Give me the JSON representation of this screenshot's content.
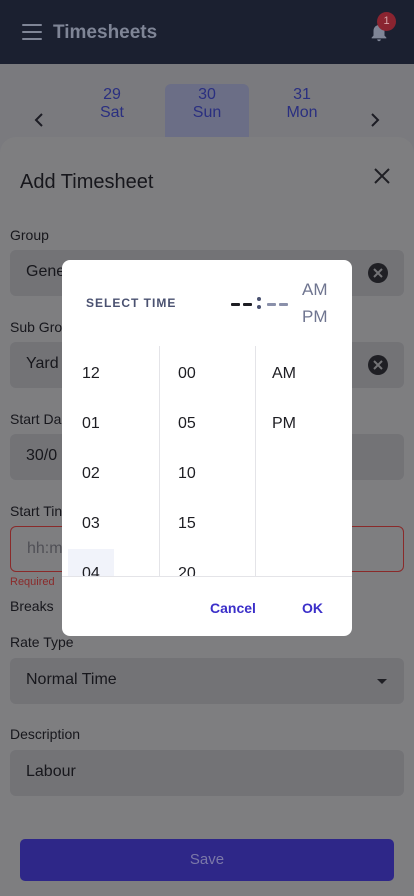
{
  "app_bar": {
    "title": "Timesheets",
    "notification_count": "1"
  },
  "date_strip": {
    "days": [
      {
        "date": "29",
        "weekday": "Sat"
      },
      {
        "date": "30",
        "weekday": "Sun"
      },
      {
        "date": "31",
        "weekday": "Mon"
      }
    ],
    "selected_index": 1
  },
  "sheet": {
    "title": "Add Timesheet",
    "group_label": "Group",
    "group_value": "Gene",
    "subgroup_label": "Sub Gro",
    "subgroup_value": "Yard",
    "start_date_label": "Start Da",
    "start_date_value": "30/0",
    "start_time_label": "Start Tin",
    "start_time_placeholder": "hh:m",
    "start_time_error": "Required",
    "breaks_label": "Breaks",
    "rate_type_label": "Rate Type",
    "rate_type_value": "Normal Time",
    "description_label": "Description",
    "description_value": "Labour",
    "save_label": "Save"
  },
  "time_picker": {
    "title": "SELECT TIME",
    "am_label": "AM",
    "pm_label": "PM",
    "hours": [
      "12",
      "01",
      "02",
      "03",
      "04"
    ],
    "minutes": [
      "00",
      "05",
      "10",
      "15",
      "20"
    ],
    "periods": [
      "AM",
      "PM"
    ],
    "cancel_label": "Cancel",
    "ok_label": "OK"
  },
  "colors": {
    "accent": "#3b2fc9",
    "error": "#8a2a2a",
    "save_button": "#2e2788"
  }
}
